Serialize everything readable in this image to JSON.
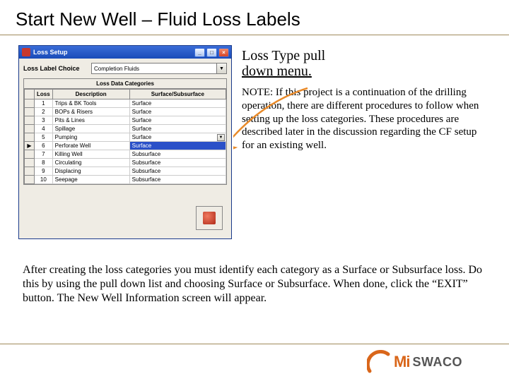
{
  "title": "Start New Well – Fluid Loss Labels",
  "dialog": {
    "title": "Loss Setup",
    "labelChoiceLabel": "Loss Label Choice",
    "labelChoiceValue": "Completion Fluids",
    "gridTitle": "Loss Data Categories",
    "headers": {
      "loss": "Loss",
      "desc": "Description",
      "ss": "Surface/Subsurface"
    },
    "rows": [
      {
        "n": "1",
        "desc": "Trips & BK Tools",
        "ss": "Surface"
      },
      {
        "n": "2",
        "desc": "BOPs & Risers",
        "ss": "Surface"
      },
      {
        "n": "3",
        "desc": "Pits & Lines",
        "ss": "Surface"
      },
      {
        "n": "4",
        "desc": "Spillage",
        "ss": "Surface"
      },
      {
        "n": "5",
        "desc": "Pumping",
        "ss": "Surface"
      },
      {
        "n": "6",
        "desc": "Perforate Well",
        "ss": "Surface",
        "selected": true
      },
      {
        "n": "7",
        "desc": "Killing Well",
        "ss": "Subsurface"
      },
      {
        "n": "8",
        "desc": "Circulating",
        "ss": "Subsurface"
      },
      {
        "n": "9",
        "desc": "Displacing",
        "ss": "Subsurface"
      },
      {
        "n": "10",
        "desc": "Seepage",
        "ss": "Subsurface"
      }
    ]
  },
  "right": {
    "callout1": "Loss Type pull",
    "callout2": "down menu.",
    "note": "NOTE:  If this project is a continuation of  the drilling operation, there are different procedures to follow when setting up the loss categories. These procedures are described later in the discussion regarding the CF setup for an existing well."
  },
  "bottom": "After creating the loss categories you must identify each category as a Surface or  Subsurface loss. Do this by using the pull down list and choosing Surface or Subsurface. When done, click the “EXIT” button. The New Well Information screen will appear.",
  "logo": {
    "a": "Mi",
    "b": "SWACO"
  }
}
